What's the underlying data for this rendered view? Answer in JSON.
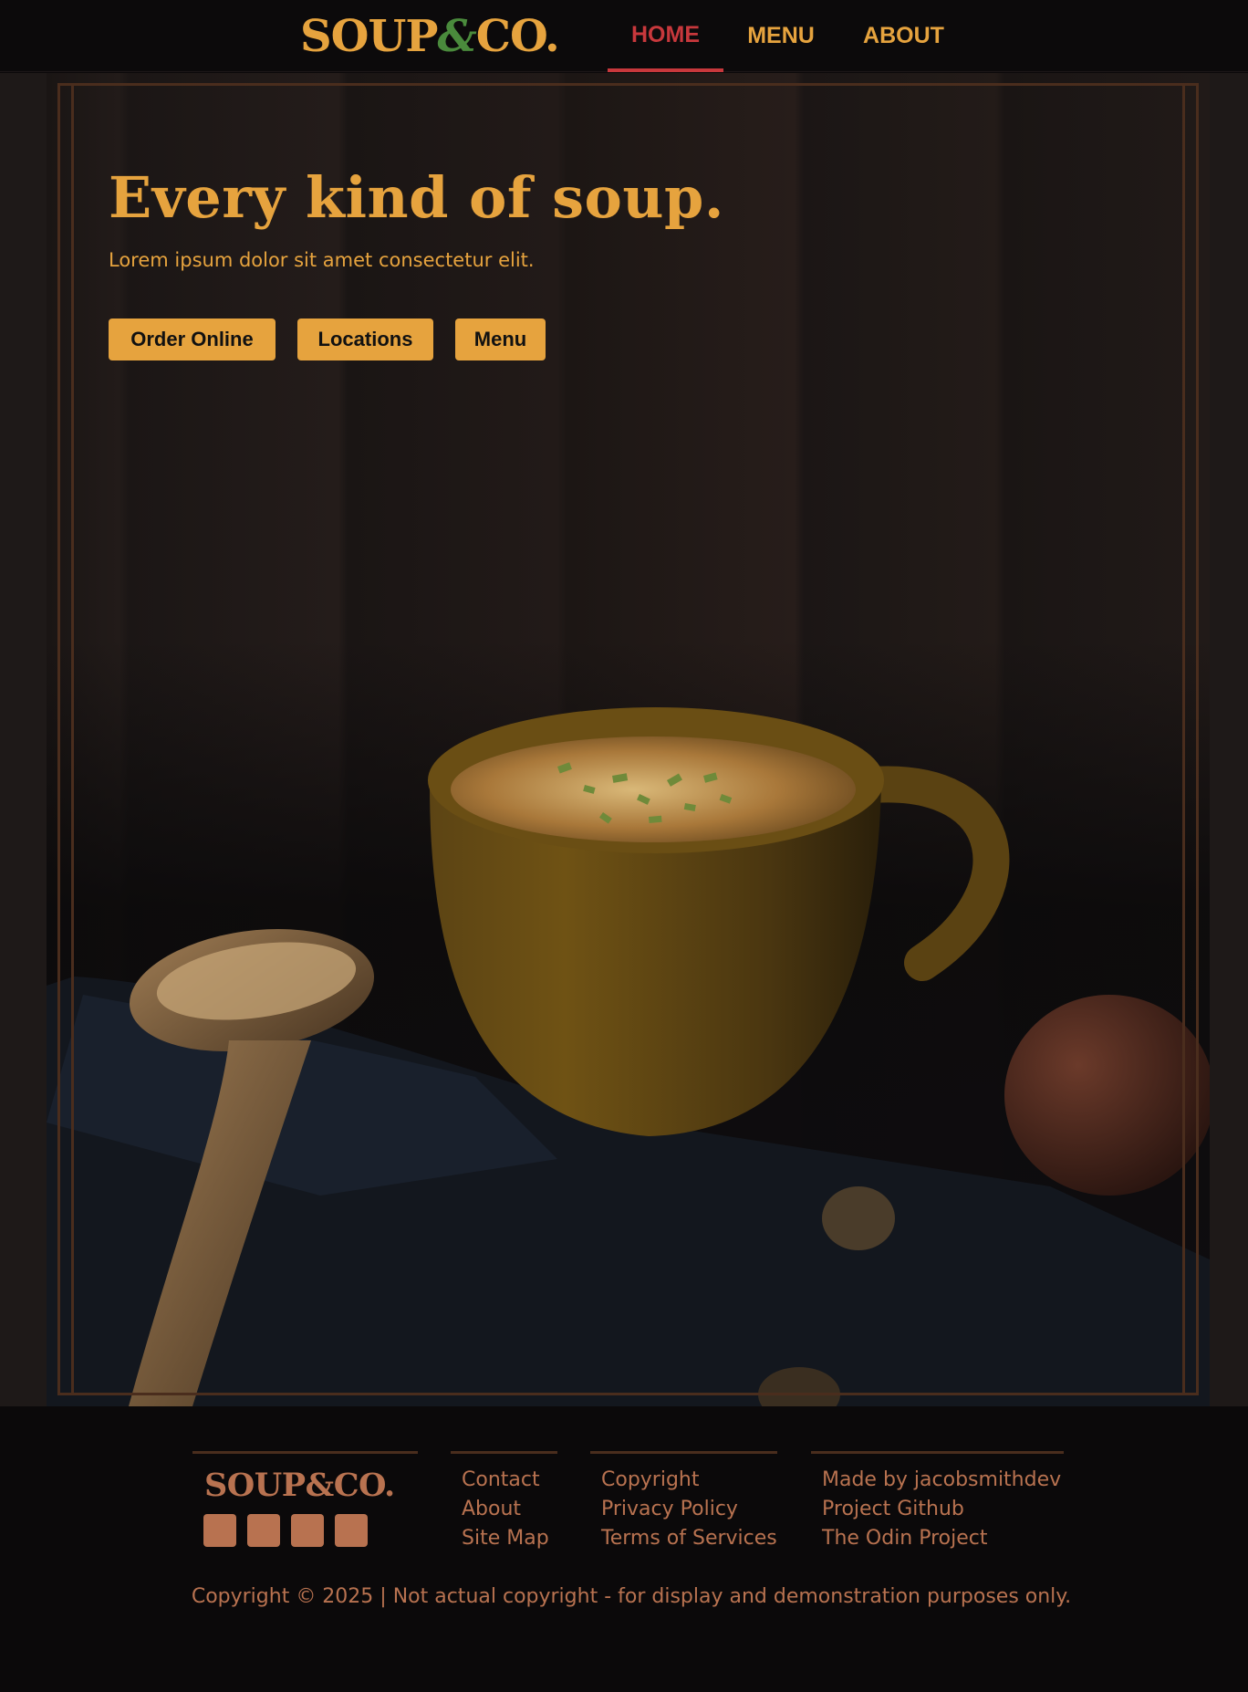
{
  "header": {
    "logo_main": "SOUP",
    "logo_amp": "&",
    "logo_end": "CO.",
    "nav": [
      {
        "label": "HOME",
        "active": true
      },
      {
        "label": "MENU",
        "active": false
      },
      {
        "label": "ABOUT",
        "active": false
      }
    ]
  },
  "hero": {
    "title": "Every kind of soup.",
    "subtitle": "Lorem ipsum dolor sit amet consectetur elit.",
    "buttons": [
      "Order Online",
      "Locations",
      "Menu"
    ]
  },
  "footer": {
    "logo": "SOUP&CO.",
    "social_icons": [
      "social-icon",
      "social-icon",
      "social-icon",
      "social-icon"
    ],
    "col2": [
      "Contact",
      "About",
      "Site Map"
    ],
    "col3": [
      "Copyright",
      "Privacy Policy",
      "Terms of Services"
    ],
    "col4": [
      "Made by jacobsmithdev",
      "Project Github",
      "The Odin Project"
    ],
    "copyright": "Copyright © 2025 | Not actual copyright - for display and demonstration purposes only."
  },
  "colors": {
    "accent": "#e6a33e",
    "active": "#c8383c",
    "green": "#4a8a3c",
    "footer_text": "#b87250",
    "border": "#4a2d1d"
  }
}
